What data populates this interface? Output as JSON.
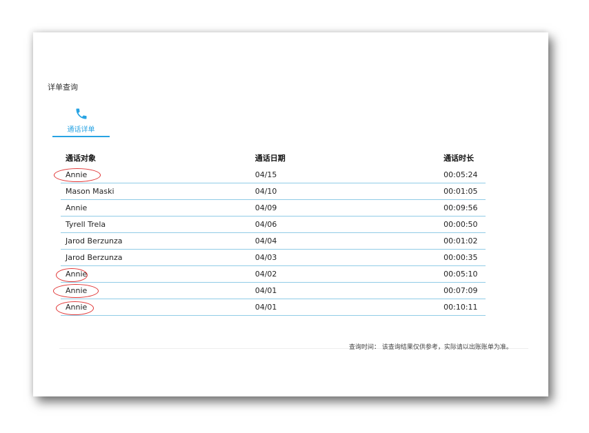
{
  "page": {
    "title": "详单查询"
  },
  "tabs": [
    {
      "label": "通话详单",
      "icon": "phone-icon",
      "active": true
    }
  ],
  "accent_color": "#27a3e3",
  "table": {
    "headers": [
      "通话对象",
      "通话日期",
      "通话时长"
    ],
    "rows": [
      {
        "contact": "Annie",
        "date": "04/15",
        "duration": "00:05:24",
        "circled": true
      },
      {
        "contact": "Mason Maski",
        "date": "04/10",
        "duration": "00:01:05",
        "circled": false
      },
      {
        "contact": "Annie",
        "date": "04/09",
        "duration": "00:09:56",
        "circled": false
      },
      {
        "contact": "Tyrell Trela",
        "date": "04/06",
        "duration": "00:00:50",
        "circled": false
      },
      {
        "contact": "Jarod Berzunza",
        "date": "04/04",
        "duration": "00:01:02",
        "circled": false
      },
      {
        "contact": "Jarod Berzunza",
        "date": "04/03",
        "duration": "00:00:35",
        "circled": false
      },
      {
        "contact": "Annie",
        "date": "04/02",
        "duration": "00:05:10",
        "circled": true
      },
      {
        "contact": "Annie",
        "date": "04/01",
        "duration": "00:07:09",
        "circled": true
      },
      {
        "contact": "Annie",
        "date": "04/01",
        "duration": "00:10:11",
        "circled": true
      }
    ]
  },
  "footer": {
    "note": "查询时间： 该查询结果仅供参考，实际请以出账账单为准。"
  }
}
